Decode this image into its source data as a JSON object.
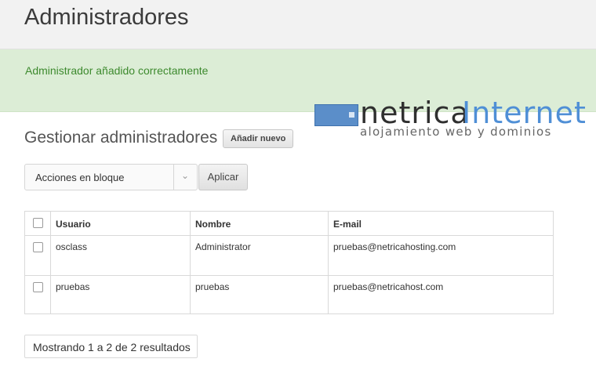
{
  "page": {
    "title": "Administradores"
  },
  "flash": {
    "message": "Administrador añadido correctamente"
  },
  "logo": {
    "word1": "netrica",
    "word2": "Internet",
    "tagline": "alojamiento web y dominios"
  },
  "section": {
    "title": "Gestionar administradores",
    "add_button": "Añadir nuevo"
  },
  "bulk": {
    "selected": "Acciones en bloque",
    "apply_label": "Aplicar"
  },
  "table": {
    "headers": [
      "Usuario",
      "Nombre",
      "E-mail"
    ],
    "rows": [
      {
        "usuario": "osclass",
        "nombre": "Administrator",
        "email": "pruebas@netricahosting.com"
      },
      {
        "usuario": "pruebas",
        "nombre": "pruebas",
        "email": "pruebas@netricahost.com"
      }
    ]
  },
  "pagination": {
    "summary": "Mostrando 1 a 2 de 2 resultados"
  },
  "colors": {
    "success_bg": "#dcedd6",
    "success_text": "#3d8a2e",
    "logo_blue": "#4f8fd6"
  }
}
